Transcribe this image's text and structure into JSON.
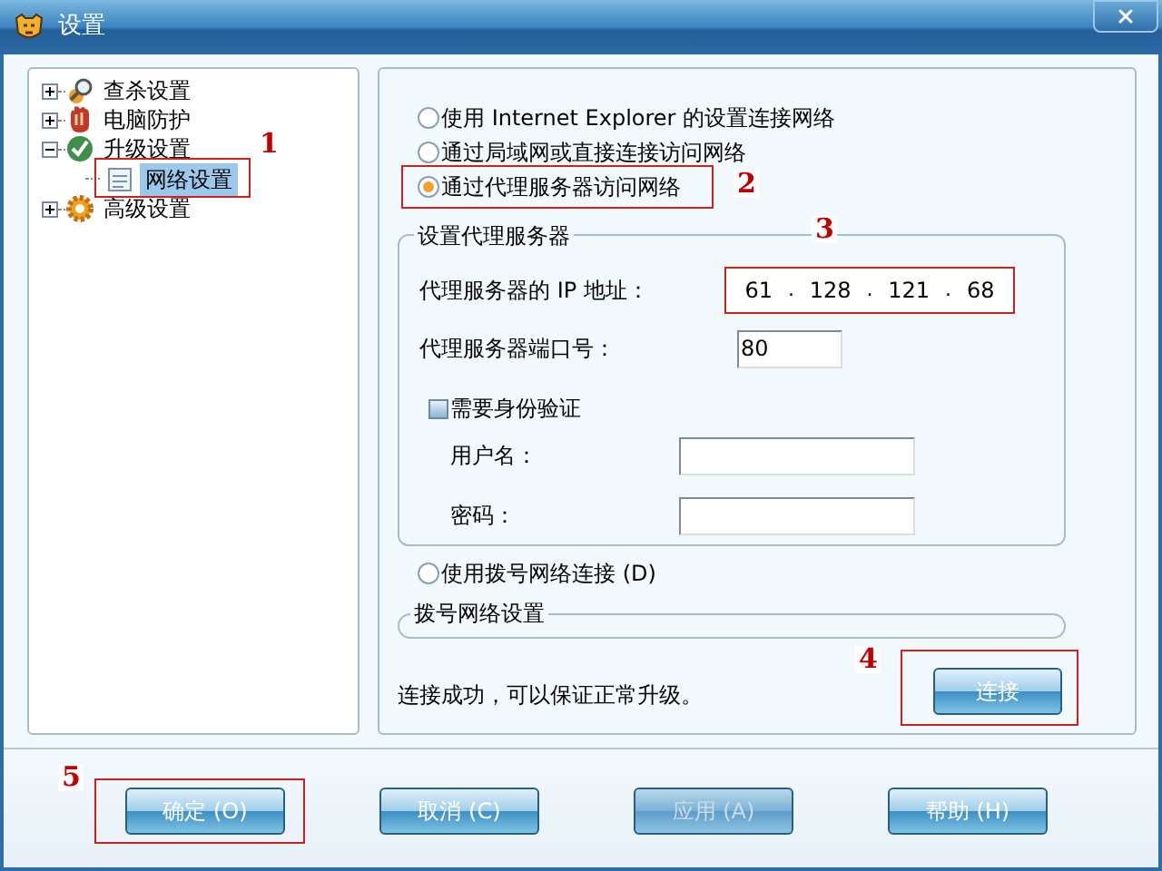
{
  "window": {
    "title": "设置"
  },
  "tree": [
    {
      "label": "查杀设置",
      "expanded": false,
      "selected": false
    },
    {
      "label": "电脑防护",
      "expanded": false,
      "selected": false
    },
    {
      "label": "升级设置",
      "expanded": true,
      "selected": false,
      "children": [
        {
          "label": "网络设置",
          "selected": true,
          "callout": "1"
        }
      ]
    },
    {
      "label": "高级设置",
      "expanded": false,
      "selected": false
    }
  ],
  "connection_options": [
    {
      "label": "使用 Internet Explorer 的设置连接网络",
      "selected": false
    },
    {
      "label": "通过局域网或直接连接访问网络",
      "selected": false
    },
    {
      "label": "通过代理服务器访问网络",
      "selected": true,
      "callout": "2"
    },
    {
      "label": "使用拨号网络连接 (D)",
      "selected": false
    }
  ],
  "proxy": {
    "title": "设置代理服务器",
    "ip_label": "代理服务器的 IP 地址：",
    "ip_callout": "3",
    "ip_parts": [
      {
        "kind": "octet",
        "text": "61"
      },
      {
        "kind": "dot",
        "text": "."
      },
      {
        "kind": "octet",
        "text": "128"
      },
      {
        "kind": "dot",
        "text": "."
      },
      {
        "kind": "octet",
        "text": "121"
      },
      {
        "kind": "dot",
        "text": "."
      },
      {
        "kind": "octet",
        "text": "68"
      }
    ],
    "port_label": "代理服务器端口号：",
    "port_value": "80",
    "auth": {
      "label": "需要身份验证",
      "checked": false
    },
    "username_label": "用户名：",
    "password_label": "密码："
  },
  "dialup": {
    "title": "拨号网络设置"
  },
  "status_text": "连接成功，可以保证正常升级。",
  "connect_button": {
    "label": "连接",
    "callout": "4"
  },
  "buttons": [
    {
      "label": "确定 (O)",
      "disabled": false,
      "callout": "5"
    },
    {
      "label": "取消 (C)",
      "disabled": false
    },
    {
      "label": "应用 (A)",
      "disabled": true
    },
    {
      "label": "帮助 (H)",
      "disabled": false
    }
  ]
}
